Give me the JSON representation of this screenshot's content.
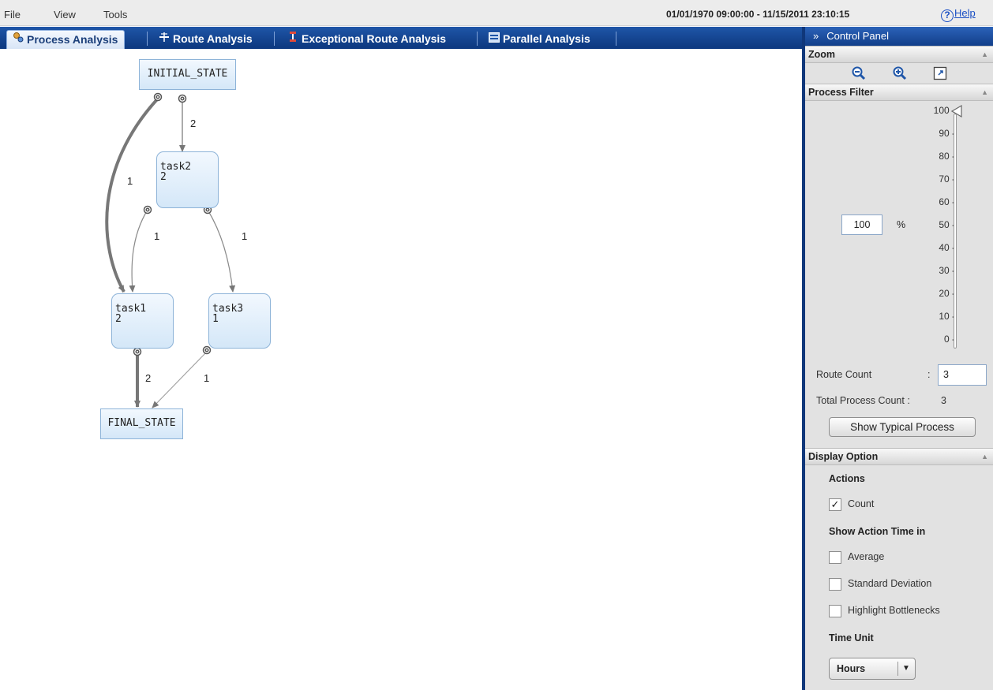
{
  "menu": {
    "file": "File",
    "view": "View",
    "tools": "Tools"
  },
  "date_range": "01/01/1970 09:00:00 - 11/15/2011 23:10:15",
  "help": {
    "icon": "help-icon",
    "label": "Help"
  },
  "tabs": [
    {
      "label": "Process Analysis",
      "icon": "process-icon",
      "active": true
    },
    {
      "label": "Route Analysis",
      "icon": "route-icon",
      "active": false
    },
    {
      "label": "Exceptional Route Analysis",
      "icon": "exception-icon",
      "active": false
    },
    {
      "label": "Parallel Analysis",
      "icon": "parallel-icon",
      "active": false
    }
  ],
  "graph": {
    "nodes": {
      "initial": "INITIAL_STATE",
      "final": "FINAL_STATE",
      "task2": {
        "name": "task2",
        "count": "2"
      },
      "task1": {
        "name": "task1",
        "count": "2"
      },
      "task3": {
        "name": "task3",
        "count": "1"
      }
    },
    "edges": {
      "initial_task2": "2",
      "initial_task1": "1",
      "task2_task1": "1",
      "task2_task3": "1",
      "task1_final": "2",
      "task3_final": "1"
    }
  },
  "control_panel": {
    "title": "Control Panel",
    "collapse_icon": "double-chevron-right-icon",
    "zoom": {
      "title": "Zoom",
      "icons": [
        "zoom-out-icon",
        "zoom-in-icon",
        "fit-icon"
      ]
    },
    "process_filter": {
      "title": "Process Filter",
      "ticks": [
        "100 -",
        "90 -",
        "80 -",
        "70 -",
        "60 -",
        "50 -",
        "40 -",
        "30 -",
        "20 -",
        "10 -",
        "0 -"
      ],
      "percent_value": "100",
      "percent_sign": "%",
      "slider_value": 100,
      "route_count_label": "Route Count",
      "route_count_colon": ":",
      "route_count_value": "3",
      "total_label": "Total Process Count :",
      "total_value": "3",
      "show_typical_button": "Show Typical Process"
    },
    "display_option": {
      "title": "Display Option",
      "actions_label": "Actions",
      "count_label": "Count",
      "count_checked": true,
      "show_action_time_label": "Show Action Time in",
      "average_label": "Average",
      "stddev_label": "Standard Deviation",
      "highlight_label": "Highlight Bottlenecks",
      "time_unit_label": "Time Unit",
      "time_unit_value": "Hours",
      "check_mark": "✓",
      "dropdown_arrow": "▼"
    }
  }
}
